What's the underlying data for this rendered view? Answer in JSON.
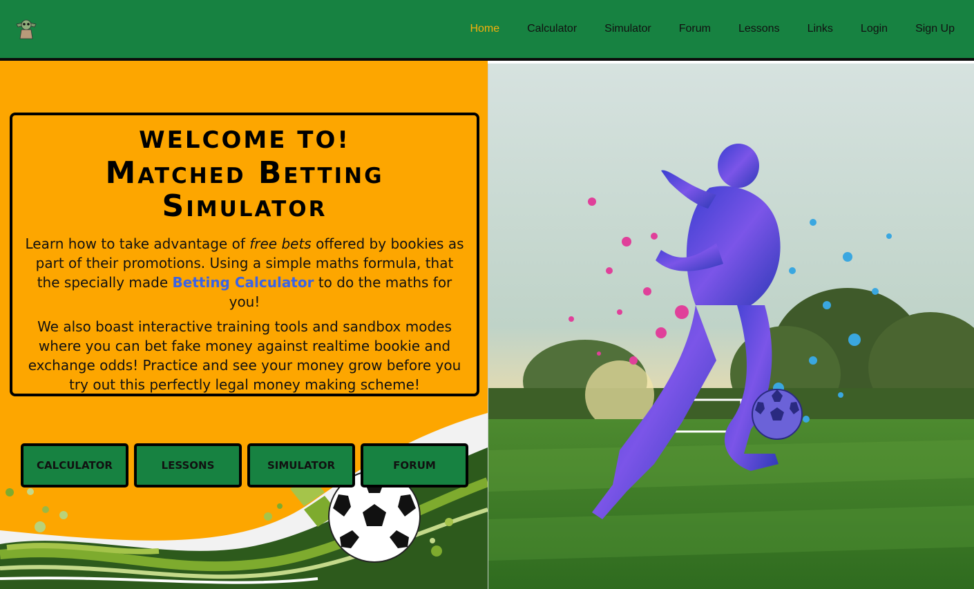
{
  "nav": {
    "logo_icon": "baby-yoda-logo-icon",
    "links": [
      {
        "label": "Home",
        "active": true
      },
      {
        "label": "Calculator",
        "active": false
      },
      {
        "label": "Simulator",
        "active": false
      },
      {
        "label": "Forum",
        "active": false
      },
      {
        "label": "Lessons",
        "active": false
      },
      {
        "label": "Links",
        "active": false
      },
      {
        "label": "Login",
        "active": false
      },
      {
        "label": "Sign Up",
        "active": false
      }
    ]
  },
  "welcome": {
    "heading": "WELCOME TO!",
    "title": "Matched Betting Simulator",
    "p1_before": "Learn how to take advantage of ",
    "p1_emphasis": "free bets",
    "p1_middle": " offered by bookies as part of their promotions. Using a simple maths formula, that the specially made ",
    "p1_link": "Betting Calculator",
    "p1_after": " to do the maths for you!",
    "p2": "We also boast interactive training tools and sandbox modes where you can bet fake money against realtime bookie and exchange odds! Practice and see your money grow before you try out this perfectly legal money making scheme!"
  },
  "buttons": [
    {
      "label": "CALCULATOR"
    },
    {
      "label": "LESSONS"
    },
    {
      "label": "SIMULATOR"
    },
    {
      "label": "FORUM"
    }
  ],
  "colors": {
    "nav_green": "#178241",
    "accent_orange": "#fda600",
    "active_link": "#f5b10b",
    "link_blue": "#3a63e6"
  }
}
